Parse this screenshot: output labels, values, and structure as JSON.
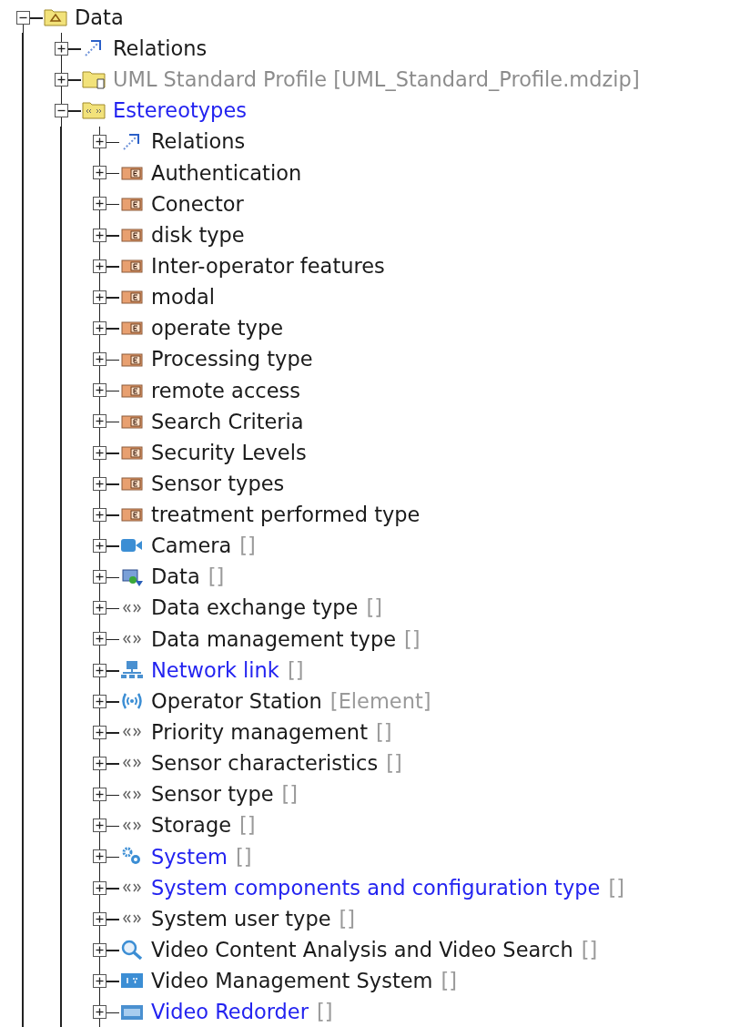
{
  "tree": [
    {
      "label": "Data",
      "kind": "model",
      "highlighted": false,
      "read_only": false,
      "expanded": true,
      "children": [
        {
          "label": "Relations",
          "kind": "relations",
          "highlighted": false,
          "read_only": false,
          "expanded": false
        },
        {
          "label": "UML Standard Profile [UML_Standard_Profile.mdzip]",
          "kind": "profile",
          "highlighted": false,
          "read_only": true,
          "expanded": false
        },
        {
          "label": "Estereotypes",
          "kind": "stereotype_package",
          "highlighted": true,
          "read_only": false,
          "expanded": true,
          "children": [
            {
              "label": "Relations",
              "kind": "relations",
              "highlighted": false,
              "read_only": false,
              "expanded": false
            },
            {
              "label": "Authentication",
              "kind": "enumeration",
              "highlighted": false,
              "read_only": false,
              "expanded": false
            },
            {
              "label": "Conector",
              "kind": "enumeration",
              "highlighted": false,
              "read_only": false,
              "expanded": false
            },
            {
              "label": "disk type",
              "kind": "enumeration",
              "highlighted": false,
              "read_only": false,
              "expanded": false
            },
            {
              "label": "Inter-operator features",
              "kind": "enumeration",
              "highlighted": false,
              "read_only": false,
              "expanded": false
            },
            {
              "label": "modal",
              "kind": "enumeration",
              "highlighted": false,
              "read_only": false,
              "expanded": false
            },
            {
              "label": "operate type",
              "kind": "enumeration",
              "highlighted": false,
              "read_only": false,
              "expanded": false
            },
            {
              "label": "Processing type",
              "kind": "enumeration",
              "highlighted": false,
              "read_only": false,
              "expanded": false
            },
            {
              "label": "remote access",
              "kind": "enumeration",
              "highlighted": false,
              "read_only": false,
              "expanded": false
            },
            {
              "label": "Search Criteria",
              "kind": "enumeration",
              "highlighted": false,
              "read_only": false,
              "expanded": false
            },
            {
              "label": "Security Levels",
              "kind": "enumeration",
              "highlighted": false,
              "read_only": false,
              "expanded": false
            },
            {
              "label": "Sensor types",
              "kind": "enumeration",
              "highlighted": false,
              "read_only": false,
              "expanded": false
            },
            {
              "label": "treatment performed type",
              "kind": "enumeration",
              "highlighted": false,
              "read_only": false,
              "expanded": false
            },
            {
              "label": "Camera",
              "suffix": "[]",
              "kind": "camera",
              "highlighted": false,
              "read_only": false,
              "expanded": false
            },
            {
              "label": "Data",
              "suffix": "[]",
              "kind": "data",
              "highlighted": false,
              "read_only": false,
              "expanded": false
            },
            {
              "label": "Data exchange type",
              "suffix": "[]",
              "kind": "stereotype",
              "highlighted": false,
              "read_only": false,
              "expanded": false
            },
            {
              "label": "Data management type",
              "suffix": "[]",
              "kind": "stereotype",
              "highlighted": false,
              "read_only": false,
              "expanded": false
            },
            {
              "label": "Network link",
              "suffix": "[]",
              "kind": "network",
              "highlighted": true,
              "read_only": false,
              "expanded": false
            },
            {
              "label": "Operator Station",
              "suffix": "[Element]",
              "kind": "signal",
              "highlighted": false,
              "read_only": false,
              "expanded": false
            },
            {
              "label": "Priority management",
              "suffix": "[]",
              "kind": "stereotype",
              "highlighted": false,
              "read_only": false,
              "expanded": false
            },
            {
              "label": "Sensor characteristics",
              "suffix": "[]",
              "kind": "stereotype",
              "highlighted": false,
              "read_only": false,
              "expanded": false
            },
            {
              "label": "Sensor type",
              "suffix": "[]",
              "kind": "stereotype",
              "highlighted": false,
              "read_only": false,
              "expanded": false
            },
            {
              "label": "Storage",
              "suffix": "[]",
              "kind": "stereotype",
              "highlighted": false,
              "read_only": false,
              "expanded": false
            },
            {
              "label": "System",
              "suffix": "[]",
              "kind": "gears",
              "highlighted": true,
              "read_only": false,
              "expanded": false
            },
            {
              "label": "System components and configuration type",
              "suffix": "[]",
              "kind": "stereotype",
              "highlighted": true,
              "read_only": false,
              "expanded": false
            },
            {
              "label": "System user type",
              "suffix": "[]",
              "kind": "stereotype",
              "highlighted": false,
              "read_only": false,
              "expanded": false
            },
            {
              "label": "Video Content Analysis and Video Search",
              "suffix": "[]",
              "kind": "search",
              "highlighted": false,
              "read_only": false,
              "expanded": false
            },
            {
              "label": "Video Management System",
              "suffix": "[]",
              "kind": "monitor",
              "highlighted": false,
              "read_only": false,
              "expanded": false
            },
            {
              "label": "Video Redorder",
              "suffix": "[]",
              "kind": "recorder",
              "highlighted": true,
              "read_only": false,
              "expanded": false
            }
          ]
        }
      ]
    }
  ]
}
